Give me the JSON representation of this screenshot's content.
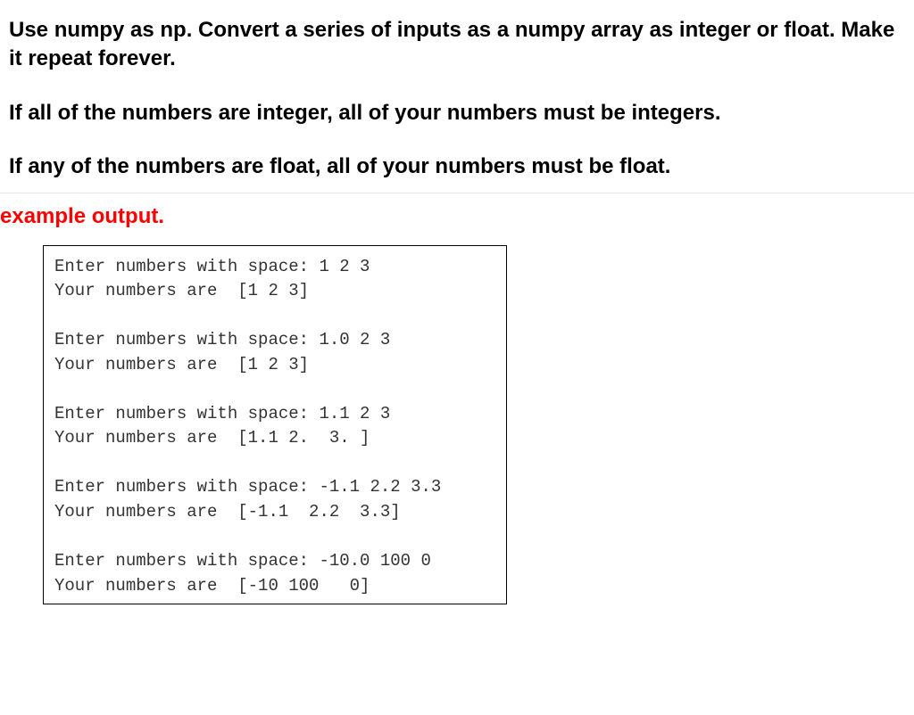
{
  "instructions": {
    "p1": "Use numpy as np. Convert a series of inputs as a numpy array as integer or float. Make it repeat forever.",
    "p2": "If all of the numbers are integer, all of your numbers must be integers.",
    "p3": "If any of the numbers are float, all of your numbers must be float."
  },
  "example_header": "example output.",
  "code_output": "Enter numbers with space: 1 2 3\nYour numbers are  [1 2 3]\n\nEnter numbers with space: 1.0 2 3\nYour numbers are  [1 2 3]\n\nEnter numbers with space: 1.1 2 3\nYour numbers are  [1.1 2.  3. ]\n\nEnter numbers with space: -1.1 2.2 3.3\nYour numbers are  [-1.1  2.2  3.3]\n\nEnter numbers with space: -10.0 100 0\nYour numbers are  [-10 100   0]"
}
